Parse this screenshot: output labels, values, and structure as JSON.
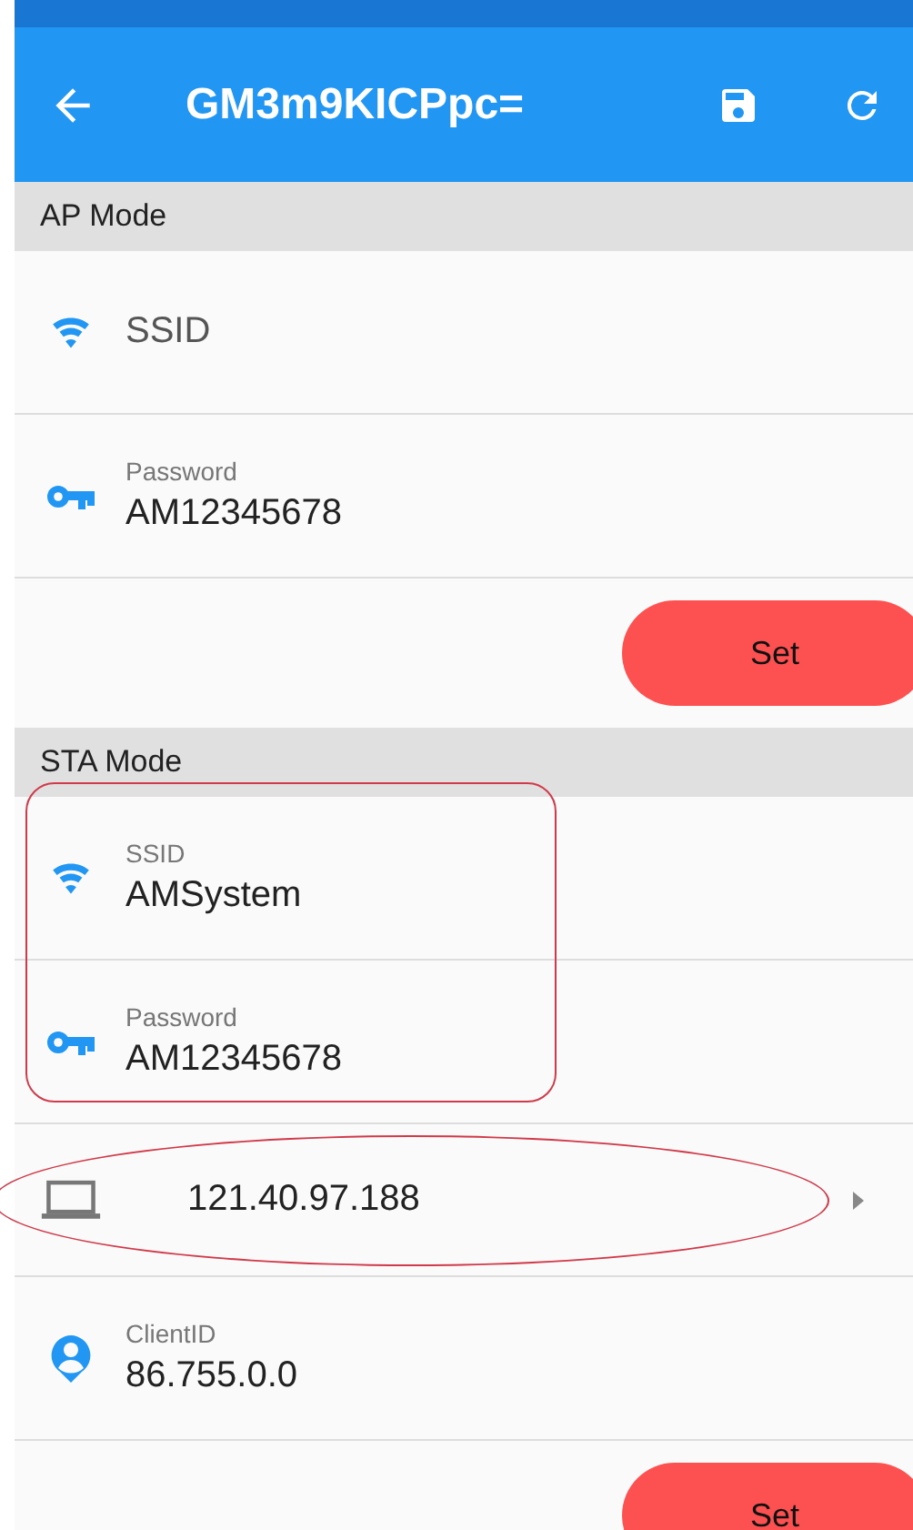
{
  "app_bar": {
    "title": "GM3m9KICPpc="
  },
  "sections": [
    {
      "title": "AP Mode",
      "fields": [
        {
          "kind": "ssid",
          "placeholder": "SSID"
        },
        {
          "kind": "password",
          "label": "Password",
          "value": "AM12345678"
        }
      ],
      "button": "Set"
    },
    {
      "title": "STA Mode",
      "fields": [
        {
          "kind": "ssid",
          "label": "SSID",
          "value": "AMSystem",
          "outline": {
            "kind": "box"
          }
        },
        {
          "kind": "password",
          "label": "Password",
          "value": "AM12345678",
          "outline": {
            "kind": "box"
          }
        },
        {
          "kind": "host",
          "value": "121.40.97.188",
          "outline": {
            "kind": "oval"
          }
        },
        {
          "kind": "client",
          "label": "ClientID",
          "value": "86.755.0.0"
        }
      ],
      "button": "Set"
    }
  ]
}
